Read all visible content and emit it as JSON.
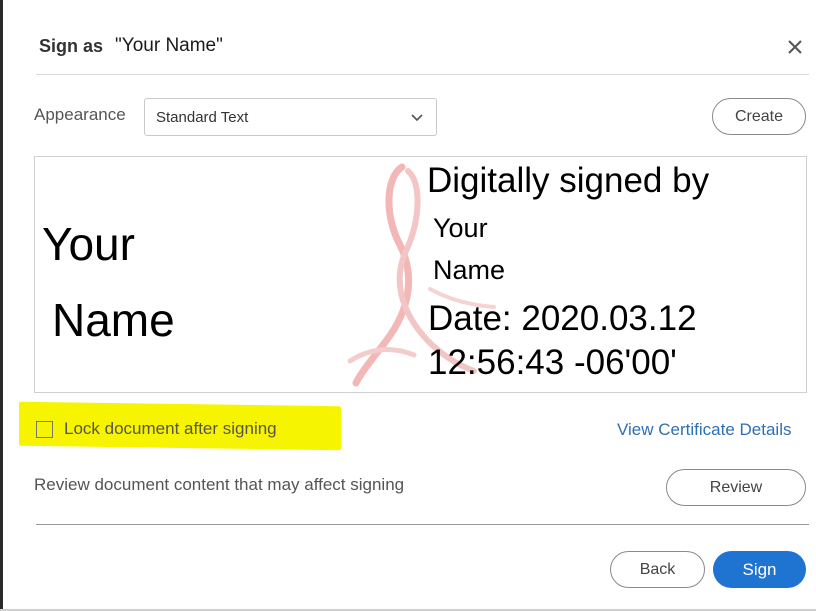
{
  "dialog": {
    "title_label": "Sign as",
    "signer_name": "\"Your Name\"",
    "close_icon": "close-icon"
  },
  "appearance": {
    "label": "Appearance",
    "selected": "Standard Text",
    "chevron_icon": "chevron-down-icon",
    "create_label": "Create"
  },
  "preview": {
    "left_line1": "Your",
    "left_line2": "Name",
    "right_heading": "Digitally signed by",
    "right_name_line1": "Your",
    "right_name_line2": "Name",
    "right_date": "Date: 2020.03.12",
    "right_time": "12:56:43 -06'00'",
    "watermark_color": "#f3b7b7"
  },
  "options": {
    "lock_label": "Lock document after signing",
    "lock_checked": false,
    "cert_link": "View Certificate Details",
    "highlight_color": "#f7f400"
  },
  "review": {
    "text": "Review document content that may affect signing",
    "button_label": "Review"
  },
  "footer": {
    "back_label": "Back",
    "sign_label": "Sign",
    "accent_color": "#1f73d1"
  }
}
